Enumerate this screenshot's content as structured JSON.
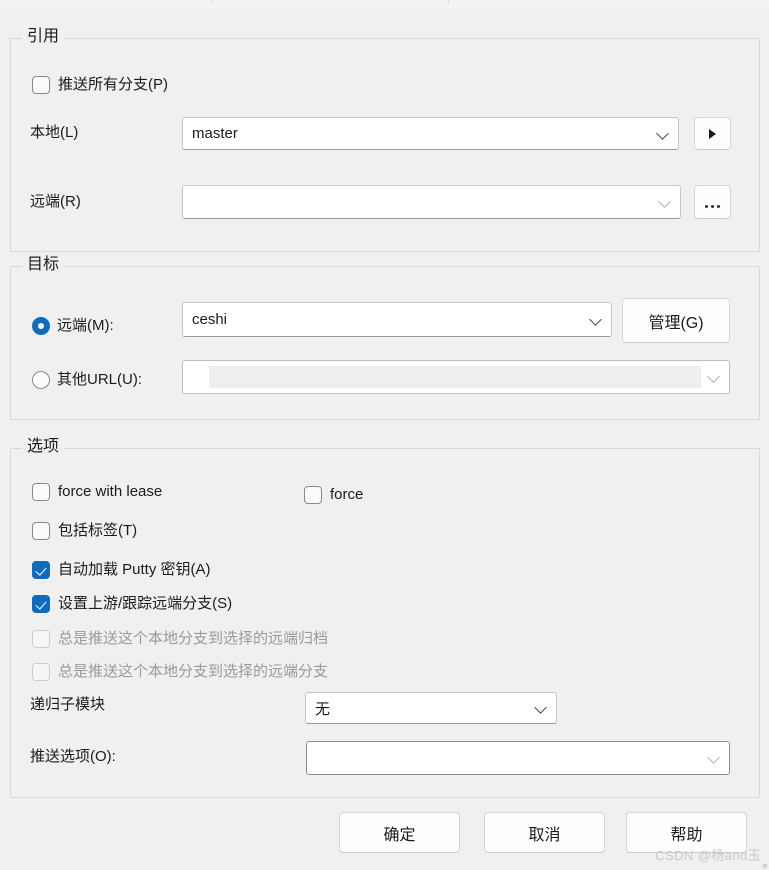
{
  "groups": {
    "refs": {
      "legend": "引用",
      "push_all_branches": "推送所有分支(P)",
      "local_label": "本地(L)",
      "local_value": "master",
      "local_expand_icon": "triangle-right-icon",
      "remote_label": "远端(R)",
      "remote_value": "",
      "remote_browse_label": "..."
    },
    "destination": {
      "legend": "目标",
      "remote_radio_label": "远端(M):",
      "remote_value": "ceshi",
      "manage_button": "管理(G)",
      "other_url_radio_label": "其他URL(U):",
      "other_url_value": ""
    },
    "options": {
      "legend": "选项",
      "force_with_lease": "force with lease",
      "force": "force",
      "include_tags": "包括标签(T)",
      "autoload_putty_key": "自动加载 Putty 密钥(A)",
      "set_upstream": "设置上游/跟踪远端分支(S)",
      "always_push_to_remote_archive": "总是推送这个本地分支到选择的远端归档",
      "always_push_to_remote_branch": "总是推送这个本地分支到选择的远端分支",
      "recursive_submodule_label": "递归子模块",
      "recursive_submodule_value": "无",
      "push_options_label": "推送选项(O):",
      "push_options_value": ""
    }
  },
  "footer": {
    "ok": "确定",
    "cancel": "取消",
    "help": "帮助"
  },
  "watermark": "CSDN @杨and玉",
  "colors": {
    "accent": "#0f6cbd",
    "window_bg": "#f0f0f0",
    "disabled_text": "#9a9a9a"
  }
}
